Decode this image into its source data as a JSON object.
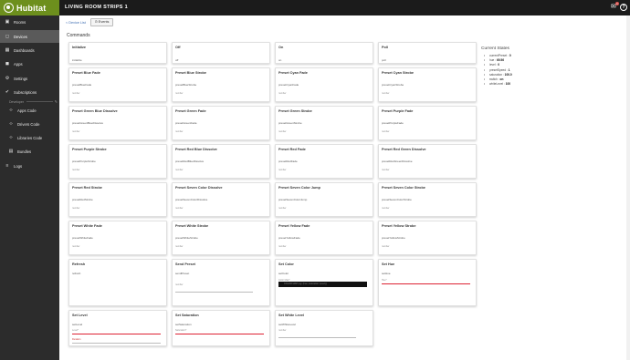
{
  "brand": {
    "name": "Hubitat"
  },
  "page_title": "LIVING ROOM STRIPS 1",
  "notifications": {
    "count": "1"
  },
  "breadcrumb": {
    "label": "< Device List"
  },
  "events_button": {
    "label": "⊙ Events"
  },
  "sidebar": {
    "items": [
      {
        "label": "Rooms",
        "icon": "rooms-icon",
        "glyph": "▣"
      },
      {
        "label": "Devices",
        "icon": "devices-icon",
        "glyph": "◻"
      },
      {
        "label": "Dashboards",
        "icon": "dashboards-icon",
        "glyph": "▦"
      },
      {
        "label": "Apps",
        "icon": "apps-icon",
        "glyph": "◼"
      },
      {
        "label": "Settings",
        "icon": "settings-icon",
        "glyph": "⚙"
      },
      {
        "label": "Subscriptions",
        "icon": "subscriptions-icon",
        "glyph": "✔"
      }
    ],
    "developer_label": "Developer",
    "dev_items": [
      {
        "label": "Apps Code",
        "icon": "code-icon",
        "glyph": "‹›"
      },
      {
        "label": "Drivers Code",
        "icon": "code-icon",
        "glyph": "‹›"
      },
      {
        "label": "Libraries Code",
        "icon": "code-icon",
        "glyph": "‹›"
      },
      {
        "label": "Bundles",
        "icon": "bundles-icon",
        "glyph": "▤"
      }
    ],
    "logs": {
      "label": "Logs",
      "icon": "logs-icon",
      "glyph": "≡"
    }
  },
  "commands": {
    "title": "Commands",
    "cards": [
      {
        "title": "Initialize",
        "command": "initialize"
      },
      {
        "title": "Off",
        "command": "off"
      },
      {
        "title": "On",
        "command": "on"
      },
      {
        "title": "Poll",
        "command": "poll"
      },
      {
        "title": "Preset Blue Fade",
        "command": "presetBlueFade",
        "number": "number"
      },
      {
        "title": "Preset Blue Strobe",
        "command": "presetBlueStrobe",
        "number": "number"
      },
      {
        "title": "Preset Cyan Fade",
        "command": "presetCyanFade",
        "number": "number"
      },
      {
        "title": "Preset Cyan Strobe",
        "command": "presetCyanStrobe",
        "number": "number"
      },
      {
        "title": "Preset Green Blue Dissolve",
        "command": "presetGreenBlueDissolve",
        "number": "number"
      },
      {
        "title": "Preset Green Fade",
        "command": "presetGreenFade",
        "number": "number"
      },
      {
        "title": "Preset Green Strobe",
        "command": "presetGreenStrobe",
        "number": "number"
      },
      {
        "title": "Preset Purple Fade",
        "command": "presetPurpleFade",
        "number": "number"
      },
      {
        "title": "Preset Purple Strobe",
        "command": "presetPurpleStrobe",
        "number": "number"
      },
      {
        "title": "Preset Red Blue Dissolve",
        "command": "presetRedBlueDissolve",
        "number": "number"
      },
      {
        "title": "Preset Red Fade",
        "command": "presetRedFade",
        "number": "number"
      },
      {
        "title": "Preset Red Green Dissolve",
        "command": "presetRedGreenDissolve",
        "number": "number"
      },
      {
        "title": "Preset Red Strobe",
        "command": "presetRedStrobe",
        "number": "number"
      },
      {
        "title": "Preset Seven Color Dissolve",
        "command": "presetSevenColorDissolve",
        "number": "number"
      },
      {
        "title": "Preset Seven Color Jump",
        "command": "presetSevenColorJump",
        "number": "number"
      },
      {
        "title": "Preset Seven Color Strobe",
        "command": "presetSevenColorStrobe",
        "number": "number"
      },
      {
        "title": "Preset White Fade",
        "command": "presetWhiteFade",
        "number": "number"
      },
      {
        "title": "Preset White Strobe",
        "command": "presetWhiteStrobe",
        "number": "number"
      },
      {
        "title": "Preset Yellow Fade",
        "command": "presetYellowFade",
        "number": "number"
      },
      {
        "title": "Preset Yellow Strobe",
        "command": "presetYellowStrobe",
        "number": "number"
      },
      {
        "title": "Refresh",
        "command": "refresh"
      },
      {
        "title": "Send Preset",
        "command": "sendPreset",
        "number": "number"
      },
      {
        "title": "Set Color",
        "command": "setColor",
        "field_label": "Color Map*",
        "field_value": "COLOR MAP (eg: {hue:,saturation:,level:})"
      },
      {
        "title": "Set Hue",
        "command": "setHue",
        "field_label": "Hue*"
      },
      {
        "title": "Set Level",
        "command": "setLevel",
        "field_label": "Level*",
        "field_label_2": "Duration"
      },
      {
        "title": "Set Saturation",
        "command": "setSaturation",
        "field_label": "Saturation*"
      },
      {
        "title": "Set White Level",
        "command": "setWhiteLevel",
        "number": "number"
      }
    ]
  },
  "current_states": {
    "title": "Current States",
    "items": [
      {
        "key": "currentPreset",
        "value": "0"
      },
      {
        "key": "hue",
        "value": "69.56"
      },
      {
        "key": "level",
        "value": "0"
      },
      {
        "key": "presetSpeed",
        "value": "1"
      },
      {
        "key": "saturation",
        "value": "100.0"
      },
      {
        "key": "switch",
        "value": "on"
      },
      {
        "key": "whiteLevel",
        "value": "100"
      }
    ]
  }
}
